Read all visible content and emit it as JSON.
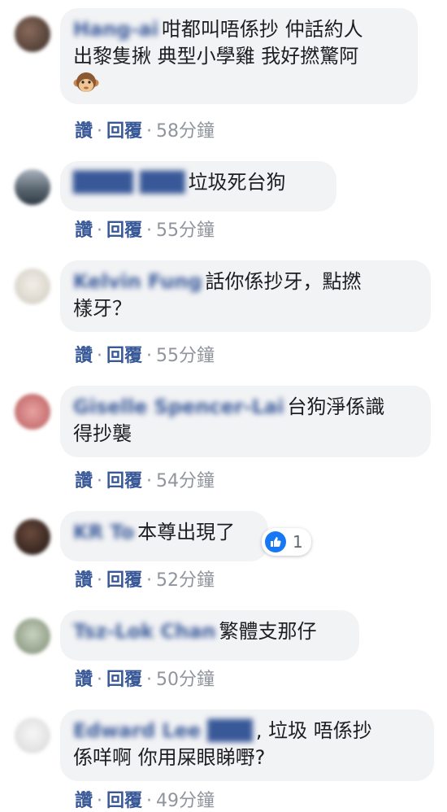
{
  "actions": {
    "like_label": "讚",
    "reply_label": "回覆",
    "separator": "·"
  },
  "comments": [
    {
      "author": "Hang-ai",
      "text": "咁都叫唔係抄 仲話約人\n出黎隻揪 典型小學雞 我好撚驚阿",
      "emoji": "monkey-icon",
      "time": "58分鐘"
    },
    {
      "author": "████ ███",
      "text": "垃圾死台狗",
      "time": "55分鐘"
    },
    {
      "author": "Kelvin Fung",
      "text": "話你係抄牙，點撚\n樣牙？",
      "time": "55分鐘"
    },
    {
      "author": "Giselle Spencer-Lai",
      "text": "台狗淨係識\n得抄襲",
      "time": "54分鐘"
    },
    {
      "author": "KR To",
      "text": "本尊出現了",
      "time": "52分鐘",
      "reaction_count": "1"
    },
    {
      "author": "Tsz-Lok Chan",
      "text": "繁體支那仔",
      "time": "50分鐘"
    },
    {
      "author": "Edward Lee ███",
      "text": ", 垃圾 唔係抄\n係咩啊 你用屎眼睇嘢?",
      "time": "49分鐘"
    }
  ]
}
